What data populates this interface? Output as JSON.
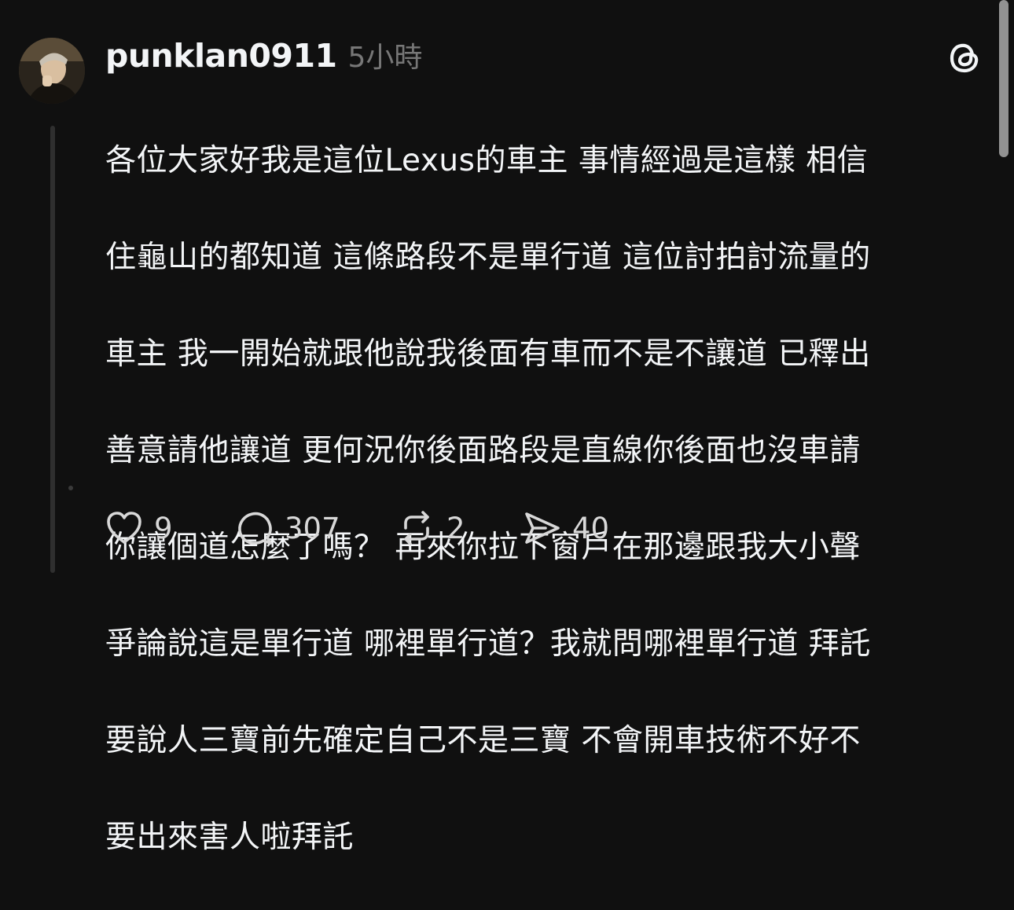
{
  "post": {
    "username": "punklan0911",
    "timestamp": "5小時",
    "body_lines": [
      "各位大家好我是這位Lexus的車主 事情經過是這樣 相信",
      "住龜山的都知道 這條路段不是單行道 這位討拍討流量的",
      "車主 我一開始就跟他說我後面有車而不是不讓道 已釋出",
      "善意請他讓道 更何況你後面路段是直線你後面也沒車請",
      "你讓個道怎麼了嗎？  再來你拉下窗戶在那邊跟我大小聲",
      "爭論說這是單行道 哪裡單行道？我就問哪裡單行道 拜託",
      "要說人三寶前先確定自己不是三寶 不會開車技術不好不",
      "要出來害人啦拜託"
    ],
    "brand_icon": "threads-logo-icon",
    "actions": {
      "like": {
        "icon": "heart-icon",
        "count": "9"
      },
      "reply": {
        "icon": "comment-icon",
        "count": "307"
      },
      "repost": {
        "icon": "repost-icon",
        "count": "2"
      },
      "share": {
        "icon": "send-icon",
        "count": "40"
      }
    }
  },
  "colors": {
    "background": "#101010",
    "text": "#f3f5f7",
    "muted": "#777777",
    "thread_line": "#2f2f2f"
  }
}
